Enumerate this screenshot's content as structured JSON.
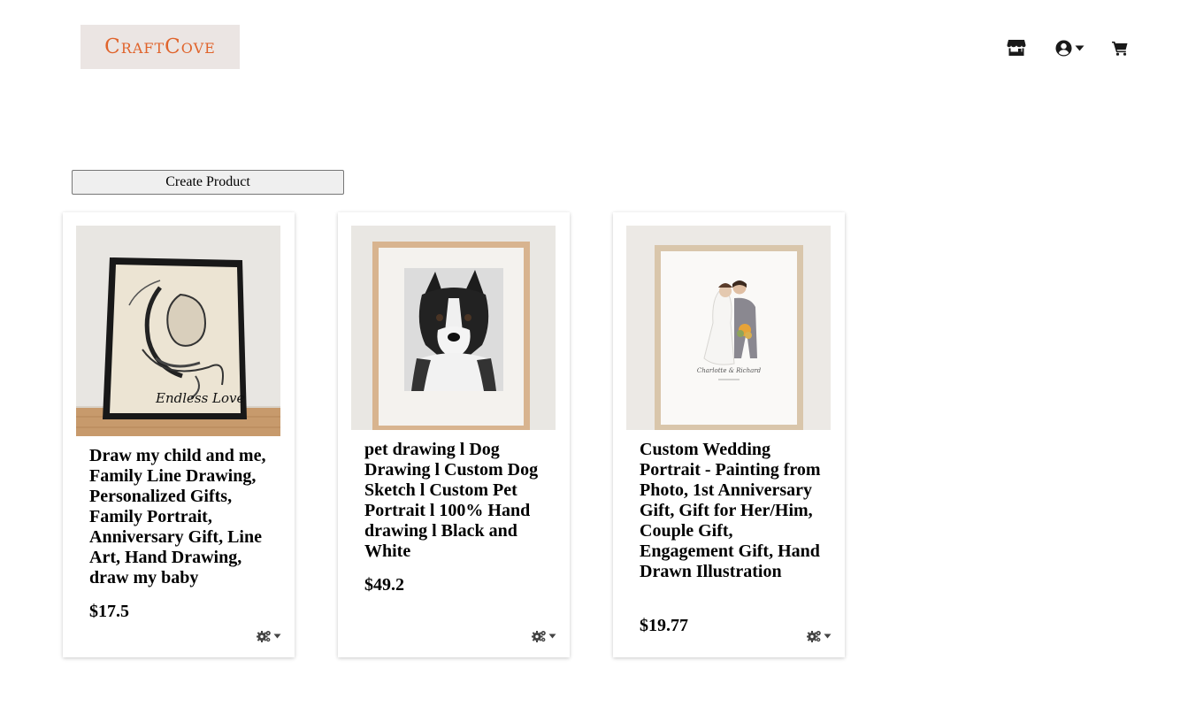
{
  "brand": {
    "logo_text": "CraftCove",
    "logo_color": "#e0642c"
  },
  "nav": {
    "icons": [
      "store-icon",
      "user-circle-icon",
      "shopping-cart-icon"
    ]
  },
  "toolbar": {
    "create_label": "Create Product"
  },
  "products": [
    {
      "title": "Draw my child and me, Family Line Drawing, Personalized Gifts, Family Portrait, Anniversary Gift, Line Art, Hand Drawing, draw my baby",
      "price": "$17.5",
      "image_signature": "Endless Love"
    },
    {
      "title": "pet drawing l Dog Drawing l Custom Dog Sketch l Custom Pet Portrait l 100% Hand drawing l Black and White",
      "price": "$49.2"
    },
    {
      "title": "Custom Wedding Portrait - Painting from Photo, 1st Anniversary Gift, Gift for Her/Him, Couple Gift, Engagement Gift, Hand Drawn Illustration",
      "price": "$19.77",
      "image_names": "Charlotte & Richard"
    }
  ]
}
